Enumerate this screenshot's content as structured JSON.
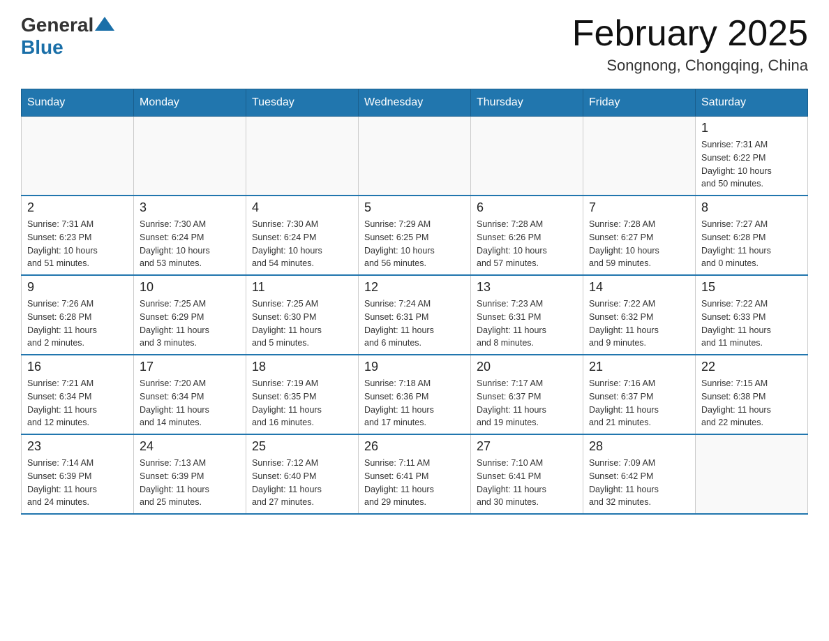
{
  "header": {
    "logo_general": "General",
    "logo_blue": "Blue",
    "main_title": "February 2025",
    "subtitle": "Songnong, Chongqing, China"
  },
  "days_of_week": [
    "Sunday",
    "Monday",
    "Tuesday",
    "Wednesday",
    "Thursday",
    "Friday",
    "Saturday"
  ],
  "weeks": [
    [
      {
        "day": "",
        "info": ""
      },
      {
        "day": "",
        "info": ""
      },
      {
        "day": "",
        "info": ""
      },
      {
        "day": "",
        "info": ""
      },
      {
        "day": "",
        "info": ""
      },
      {
        "day": "",
        "info": ""
      },
      {
        "day": "1",
        "info": "Sunrise: 7:31 AM\nSunset: 6:22 PM\nDaylight: 10 hours\nand 50 minutes."
      }
    ],
    [
      {
        "day": "2",
        "info": "Sunrise: 7:31 AM\nSunset: 6:23 PM\nDaylight: 10 hours\nand 51 minutes."
      },
      {
        "day": "3",
        "info": "Sunrise: 7:30 AM\nSunset: 6:24 PM\nDaylight: 10 hours\nand 53 minutes."
      },
      {
        "day": "4",
        "info": "Sunrise: 7:30 AM\nSunset: 6:24 PM\nDaylight: 10 hours\nand 54 minutes."
      },
      {
        "day": "5",
        "info": "Sunrise: 7:29 AM\nSunset: 6:25 PM\nDaylight: 10 hours\nand 56 minutes."
      },
      {
        "day": "6",
        "info": "Sunrise: 7:28 AM\nSunset: 6:26 PM\nDaylight: 10 hours\nand 57 minutes."
      },
      {
        "day": "7",
        "info": "Sunrise: 7:28 AM\nSunset: 6:27 PM\nDaylight: 10 hours\nand 59 minutes."
      },
      {
        "day": "8",
        "info": "Sunrise: 7:27 AM\nSunset: 6:28 PM\nDaylight: 11 hours\nand 0 minutes."
      }
    ],
    [
      {
        "day": "9",
        "info": "Sunrise: 7:26 AM\nSunset: 6:28 PM\nDaylight: 11 hours\nand 2 minutes."
      },
      {
        "day": "10",
        "info": "Sunrise: 7:25 AM\nSunset: 6:29 PM\nDaylight: 11 hours\nand 3 minutes."
      },
      {
        "day": "11",
        "info": "Sunrise: 7:25 AM\nSunset: 6:30 PM\nDaylight: 11 hours\nand 5 minutes."
      },
      {
        "day": "12",
        "info": "Sunrise: 7:24 AM\nSunset: 6:31 PM\nDaylight: 11 hours\nand 6 minutes."
      },
      {
        "day": "13",
        "info": "Sunrise: 7:23 AM\nSunset: 6:31 PM\nDaylight: 11 hours\nand 8 minutes."
      },
      {
        "day": "14",
        "info": "Sunrise: 7:22 AM\nSunset: 6:32 PM\nDaylight: 11 hours\nand 9 minutes."
      },
      {
        "day": "15",
        "info": "Sunrise: 7:22 AM\nSunset: 6:33 PM\nDaylight: 11 hours\nand 11 minutes."
      }
    ],
    [
      {
        "day": "16",
        "info": "Sunrise: 7:21 AM\nSunset: 6:34 PM\nDaylight: 11 hours\nand 12 minutes."
      },
      {
        "day": "17",
        "info": "Sunrise: 7:20 AM\nSunset: 6:34 PM\nDaylight: 11 hours\nand 14 minutes."
      },
      {
        "day": "18",
        "info": "Sunrise: 7:19 AM\nSunset: 6:35 PM\nDaylight: 11 hours\nand 16 minutes."
      },
      {
        "day": "19",
        "info": "Sunrise: 7:18 AM\nSunset: 6:36 PM\nDaylight: 11 hours\nand 17 minutes."
      },
      {
        "day": "20",
        "info": "Sunrise: 7:17 AM\nSunset: 6:37 PM\nDaylight: 11 hours\nand 19 minutes."
      },
      {
        "day": "21",
        "info": "Sunrise: 7:16 AM\nSunset: 6:37 PM\nDaylight: 11 hours\nand 21 minutes."
      },
      {
        "day": "22",
        "info": "Sunrise: 7:15 AM\nSunset: 6:38 PM\nDaylight: 11 hours\nand 22 minutes."
      }
    ],
    [
      {
        "day": "23",
        "info": "Sunrise: 7:14 AM\nSunset: 6:39 PM\nDaylight: 11 hours\nand 24 minutes."
      },
      {
        "day": "24",
        "info": "Sunrise: 7:13 AM\nSunset: 6:39 PM\nDaylight: 11 hours\nand 25 minutes."
      },
      {
        "day": "25",
        "info": "Sunrise: 7:12 AM\nSunset: 6:40 PM\nDaylight: 11 hours\nand 27 minutes."
      },
      {
        "day": "26",
        "info": "Sunrise: 7:11 AM\nSunset: 6:41 PM\nDaylight: 11 hours\nand 29 minutes."
      },
      {
        "day": "27",
        "info": "Sunrise: 7:10 AM\nSunset: 6:41 PM\nDaylight: 11 hours\nand 30 minutes."
      },
      {
        "day": "28",
        "info": "Sunrise: 7:09 AM\nSunset: 6:42 PM\nDaylight: 11 hours\nand 32 minutes."
      },
      {
        "day": "",
        "info": ""
      }
    ]
  ]
}
